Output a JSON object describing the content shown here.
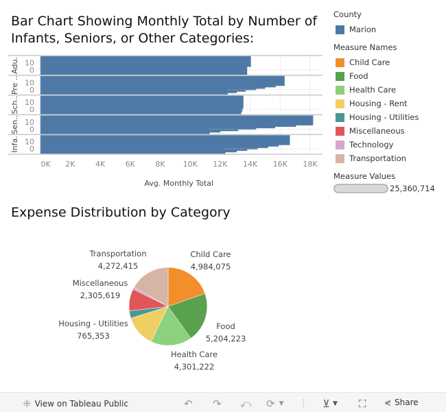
{
  "titles": {
    "bar": "Bar Chart Showing Monthly Total by Number of Infants, Seniors, or Other Categories:",
    "pie": "Expense Distribution by Category"
  },
  "legend": {
    "county_title": "County",
    "county": [
      {
        "label": "Marion",
        "color": "#4e79a7"
      }
    ],
    "measure_title": "Measure Names",
    "measures": [
      {
        "label": "Child Care",
        "color": "#f28e2b"
      },
      {
        "label": "Food",
        "color": "#59a14f"
      },
      {
        "label": "Health Care",
        "color": "#8cd17d"
      },
      {
        "label": "Housing - Rent",
        "color": "#f1ce63"
      },
      {
        "label": "Housing - Utilities",
        "color": "#499894"
      },
      {
        "label": "Miscellaneous",
        "color": "#e15759"
      },
      {
        "label": "Technology",
        "color": "#d4a6c8"
      },
      {
        "label": "Transportation",
        "color": "#d7b5a6"
      }
    ],
    "values_title": "Measure Values",
    "values_max": "25,360,714"
  },
  "chart_data": [
    {
      "type": "bar",
      "orientation": "horizontal",
      "title": "Bar Chart Showing Monthly Total by Number of Infants, Seniors, or Other Categories:",
      "xlabel": "Avg. Monthly Total",
      "xlim": [
        0,
        18500
      ],
      "xticks": [
        "0K",
        "2K",
        "4K",
        "6K",
        "8K",
        "10K",
        "12K",
        "14K",
        "16K",
        "18K"
      ],
      "xtick_values": [
        0,
        2000,
        4000,
        6000,
        8000,
        10000,
        12000,
        14000,
        16000,
        18000
      ],
      "ylim": [
        -6.5,
        19
      ],
      "yticks": [
        "10",
        "0"
      ],
      "ytick_values": [
        10,
        0
      ],
      "grid": true,
      "color": "#4e79a7",
      "groups": [
        {
          "label": "Adu.",
          "bars": [
            {
              "y": [
                4.5,
                19
              ],
              "value": 14050
            },
            {
              "y": [
                -6.5,
                4.5
              ],
              "value": 13800
            }
          ]
        },
        {
          "label": "Pre ..",
          "bars": [
            {
              "y": [
                5.5,
                19
              ],
              "value": 16300
            },
            {
              "y": [
                3.5,
                5.5
              ],
              "value": 15700
            },
            {
              "y": [
                1.5,
                3.5
              ],
              "value": 15000
            },
            {
              "y": [
                -0.5,
                1.5
              ],
              "value": 14400
            },
            {
              "y": [
                -2.5,
                -0.5
              ],
              "value": 13700
            },
            {
              "y": [
                -4.5,
                -2.5
              ],
              "value": 13100
            },
            {
              "y": [
                -6.5,
                -4.5
              ],
              "value": 12500
            }
          ]
        },
        {
          "label": "Sch..",
          "bars": [
            {
              "y": [
                2,
                19
              ],
              "value": 13550
            },
            {
              "y": [
                -1.5,
                2
              ],
              "value": 13500
            },
            {
              "y": [
                -4,
                -1.5
              ],
              "value": 13450
            },
            {
              "y": [
                -6.5,
                -4
              ],
              "value": 13400
            }
          ]
        },
        {
          "label": "Sen..",
          "bars": [
            {
              "y": [
                5.5,
                19
              ],
              "value": 18200
            },
            {
              "y": [
                3.5,
                5.5
              ],
              "value": 17060
            },
            {
              "y": [
                1.5,
                3.5
              ],
              "value": 15660
            },
            {
              "y": [
                -0.5,
                1.5
              ],
              "value": 14400
            },
            {
              "y": [
                -2.5,
                -0.5
              ],
              "value": 13200
            },
            {
              "y": [
                -4.5,
                -2.5
              ],
              "value": 12000
            },
            {
              "y": [
                -6.5,
                -4.5
              ],
              "value": 11300
            }
          ]
        },
        {
          "label": "Infa.",
          "bars": [
            {
              "y": [
                5.5,
                19
              ],
              "value": 16650
            },
            {
              "y": [
                3.5,
                5.5
              ],
              "value": 15900
            },
            {
              "y": [
                1.5,
                3.5
              ],
              "value": 15200
            },
            {
              "y": [
                -0.5,
                1.5
              ],
              "value": 14500
            },
            {
              "y": [
                -2.5,
                -0.5
              ],
              "value": 13800
            },
            {
              "y": [
                -4.5,
                -2.5
              ],
              "value": 13100
            },
            {
              "y": [
                -6.5,
                -4.5
              ],
              "value": 12350
            }
          ]
        }
      ]
    },
    {
      "type": "pie",
      "title": "Expense Distribution by Category",
      "slices": [
        {
          "label": "Child Care",
          "value": 4984075,
          "value_label": "4,984,075",
          "color": "#f28e2b",
          "show_label": true
        },
        {
          "label": "Food",
          "value": 5204223,
          "value_label": "5,204,223",
          "color": "#59a14f",
          "show_label": true
        },
        {
          "label": "Health Care",
          "value": 4301222,
          "value_label": "4,301,222",
          "color": "#8cd17d",
          "show_label": true
        },
        {
          "label": "Housing - Rent",
          "value": 3300000,
          "color": "#f1ce63",
          "show_label": false
        },
        {
          "label": "Housing - Utilities",
          "value": 765353,
          "value_label": "765,353",
          "color": "#499894",
          "show_label": true
        },
        {
          "label": "Miscellaneous",
          "value": 2305619,
          "value_label": "2,305,619",
          "color": "#e15759",
          "show_label": true
        },
        {
          "label": "Technology",
          "value": 227807,
          "color": "#d4a6c8",
          "show_label": false
        },
        {
          "label": "Transportation",
          "value": 4272415,
          "value_label": "4,272,415",
          "color": "#d7b5a6",
          "show_label": true
        }
      ]
    }
  ],
  "footer": {
    "view_label": "View on Tableau Public",
    "share_label": "Share"
  }
}
